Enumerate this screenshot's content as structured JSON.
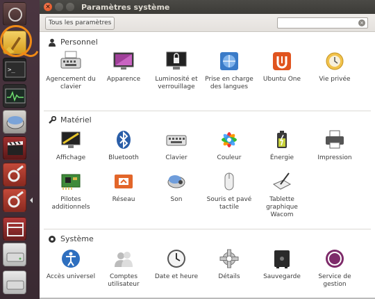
{
  "window": {
    "title": "Paramètres système"
  },
  "toolbar": {
    "all_settings_label": "Tous les paramètres",
    "search_value": "",
    "search_clear_icon": "×"
  },
  "sections": [
    {
      "title": "Personnel",
      "icon": "user-icon",
      "items": [
        {
          "label": "Agencement du clavier",
          "icon": "keyboard-layout-icon"
        },
        {
          "label": "Apparence",
          "icon": "appearance-icon"
        },
        {
          "label": "Luminosité et verrouillage",
          "icon": "brightness-lock-icon"
        },
        {
          "label": "Prise en charge des langues",
          "icon": "language-icon"
        },
        {
          "label": "Ubuntu One",
          "icon": "ubuntu-one-icon"
        },
        {
          "label": "Vie privée",
          "icon": "privacy-icon"
        }
      ]
    },
    {
      "title": "Matériel",
      "icon": "wrench-icon",
      "items": [
        {
          "label": "Affichage",
          "icon": "display-icon"
        },
        {
          "label": "Bluetooth",
          "icon": "bluetooth-icon"
        },
        {
          "label": "Clavier",
          "icon": "keyboard-icon"
        },
        {
          "label": "Couleur",
          "icon": "color-icon"
        },
        {
          "label": "Énergie",
          "icon": "power-icon"
        },
        {
          "label": "Impression",
          "icon": "printer-icon"
        },
        {
          "label": "Pilotes additionnels",
          "icon": "drivers-icon"
        },
        {
          "label": "Réseau",
          "icon": "network-icon"
        },
        {
          "label": "Son",
          "icon": "sound-icon"
        },
        {
          "label": "Souris et pavé tactile",
          "icon": "mouse-icon"
        },
        {
          "label": "Tablette graphique Wacom",
          "icon": "wacom-icon"
        }
      ]
    },
    {
      "title": "Système",
      "icon": "system-gear-icon",
      "items": [
        {
          "label": "Accès universel",
          "icon": "accessibility-icon"
        },
        {
          "label": "Comptes utilisateur",
          "icon": "user-accounts-icon"
        },
        {
          "label": "Date et heure",
          "icon": "clock-icon"
        },
        {
          "label": "Détails",
          "icon": "details-gear-icon"
        },
        {
          "label": "Sauvegarde",
          "icon": "backup-safe-icon"
        },
        {
          "label": "Service de gestion",
          "icon": "landscape-icon"
        }
      ]
    }
  ],
  "launcher": {
    "items": [
      {
        "name": "dash-home-icon"
      },
      {
        "name": "cleaner-broom-icon"
      },
      {
        "name": "terminal-icon"
      },
      {
        "name": "system-monitor-icon"
      },
      {
        "name": "disk-utility-icon"
      },
      {
        "name": "video-editor-icon"
      },
      {
        "name": "settings-tools-icon"
      },
      {
        "name": "system-settings-icon"
      },
      {
        "name": "workspace-switcher-icon"
      },
      {
        "name": "removable-drive-icon"
      },
      {
        "name": "removable-drive-2-icon"
      }
    ]
  },
  "colors": {
    "accent": "#dd4814",
    "highlight_ring": "#f08a16",
    "launcher_bg": "#3a2a32",
    "titlebar_bg": "#3c3b37"
  }
}
